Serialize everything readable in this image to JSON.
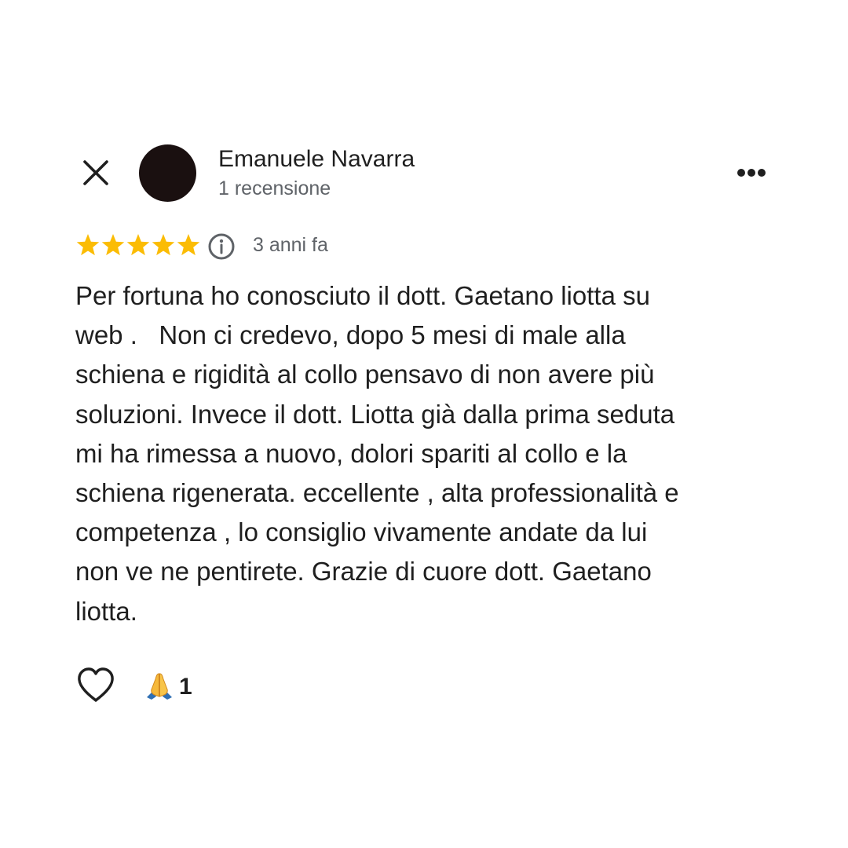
{
  "review": {
    "author_name": "Emanuele Navarra",
    "author_review_count": "1 recensione",
    "rating": 5,
    "rating_max": 5,
    "time_ago": "3 anni fa",
    "text": "Per fortuna ho conosciuto il dott. Gaetano liotta su\nweb .   Non ci credevo, dopo 5 mesi di male alla\nschiena e rigidità al collo pensavo di non avere più\nsoluzioni. Invece il dott. Liotta già dalla prima seduta\nmi ha rimessa a nuovo, dolori spariti al collo e la\nschiena rigenerata. eccellente , alta professionalità e\ncompetenza , lo consiglio vivamente andate da lui\nnon ve ne pentirete. Grazie di cuore dott. Gaetano\nliotta."
  },
  "reactions": {
    "emoji": "folded-hands-icon",
    "count": "1"
  },
  "icons": {
    "close": "close-icon",
    "more": "more-horizontal-icon",
    "info": "info-icon",
    "like": "heart-outline-icon",
    "star": "star-icon"
  },
  "colors": {
    "star": "#FBBC04",
    "text_primary": "#1f1f1f",
    "text_secondary": "#5f6368",
    "avatar": "#1a1010"
  }
}
